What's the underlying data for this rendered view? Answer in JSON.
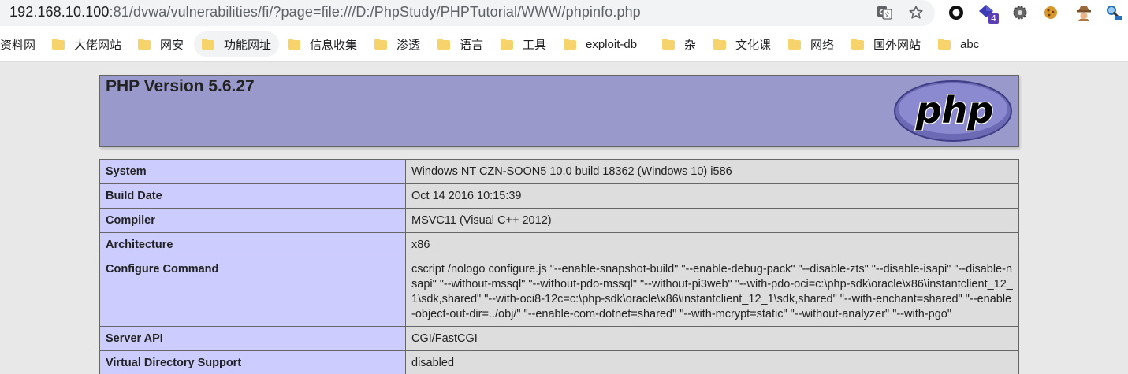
{
  "browser": {
    "url_host": "192.168.10.100",
    "url_rest": ":81/dvwa/vulnerabilities/fi/?page=file:///D:/PhpStudy/PHPTutorial/WWW/phpinfo.php",
    "translate_icon": "translate-icon",
    "star_icon": "star-icon",
    "extensions": [
      "circle-extension-icon",
      "purple-gem-extension-icon",
      "gear-extension-icon",
      "cookie-extension-icon",
      "spy-extension-icon",
      "magnifier-extension-icon"
    ],
    "extension_badge": "4"
  },
  "bookmarks": [
    {
      "label": "资料网",
      "active": false
    },
    {
      "label": "大佬网站",
      "active": false
    },
    {
      "label": "网安",
      "active": false
    },
    {
      "label": "功能网址",
      "active": true
    },
    {
      "label": "信息收集",
      "active": false
    },
    {
      "label": "渗透",
      "active": false
    },
    {
      "label": "语言",
      "active": false
    },
    {
      "label": "工具",
      "active": false
    },
    {
      "label": "exploit-db",
      "active": false
    },
    {
      "label": "杂",
      "active": false
    },
    {
      "label": "文化课",
      "active": false
    },
    {
      "label": "网络",
      "active": false
    },
    {
      "label": "国外网站",
      "active": false
    },
    {
      "label": "abc",
      "active": false
    }
  ],
  "phpinfo": {
    "title": "PHP Version 5.6.27",
    "logo_text": "php",
    "rows": [
      {
        "key": "System",
        "value": "Windows NT CZN-SOON5 10.0 build 18362 (Windows 10) i586"
      },
      {
        "key": "Build Date",
        "value": "Oct 14 2016 10:15:39"
      },
      {
        "key": "Compiler",
        "value": "MSVC11 (Visual C++ 2012)"
      },
      {
        "key": "Architecture",
        "value": "x86"
      },
      {
        "key": "Configure Command",
        "value": "cscript /nologo configure.js \"--enable-snapshot-build\" \"--enable-debug-pack\" \"--disable-zts\" \"--disable-isapi\" \"--disable-nsapi\" \"--without-mssql\" \"--without-pdo-mssql\" \"--without-pi3web\" \"--with-pdo-oci=c:\\php-sdk\\oracle\\x86\\instantclient_12_1\\sdk,shared\" \"--with-oci8-12c=c:\\php-sdk\\oracle\\x86\\instantclient_12_1\\sdk,shared\" \"--with-enchant=shared\" \"--enable-object-out-dir=../obj/\" \"--enable-com-dotnet=shared\" \"--with-mcrypt=static\" \"--without-analyzer\" \"--with-pgo\""
      },
      {
        "key": "Server API",
        "value": "CGI/FastCGI"
      },
      {
        "key": "Virtual Directory Support",
        "value": "disabled"
      }
    ]
  },
  "colors": {
    "header_bg": "#9999cc",
    "key_bg": "#ccccff",
    "value_bg": "#dddddd",
    "page_bg": "#e8e8e8",
    "folder": "#f7d36b"
  }
}
